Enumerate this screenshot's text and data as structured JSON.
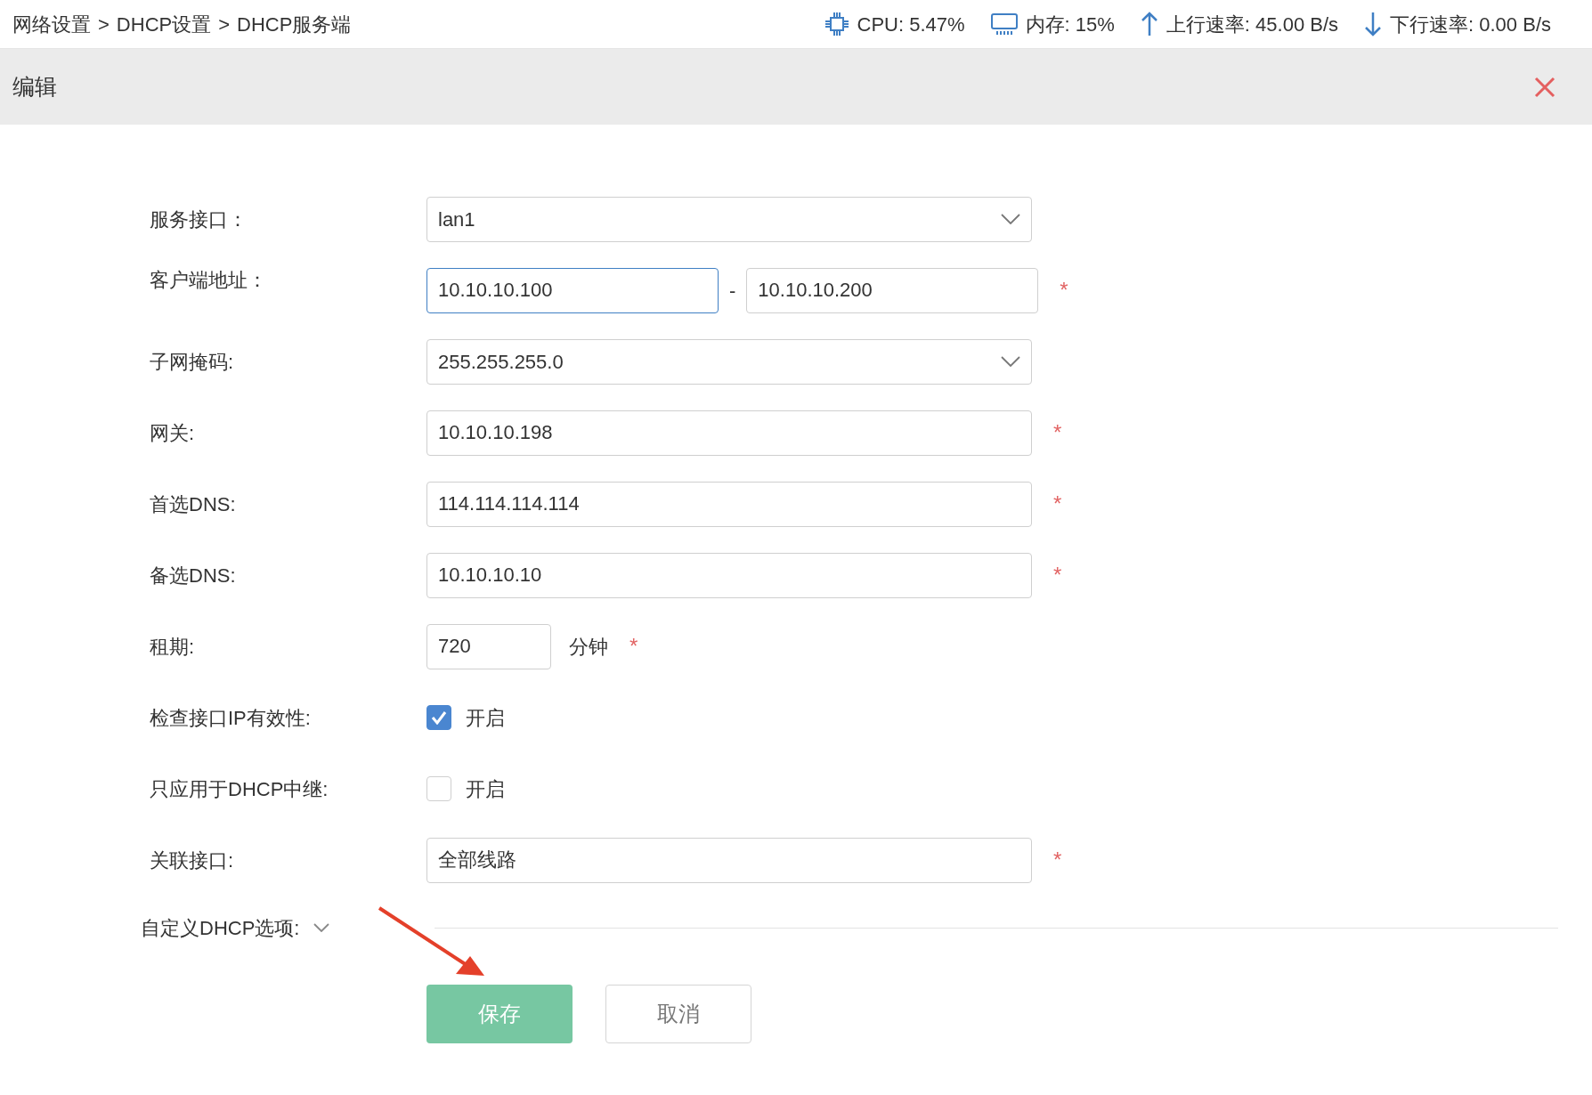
{
  "breadcrumb": [
    "网络设置",
    "DHCP设置",
    "DHCP服务端"
  ],
  "breadcrumb_separator": ">",
  "status": [
    {
      "kind": "cpu",
      "text": "CPU: 5.47%"
    },
    {
      "kind": "memory",
      "text": "内存: 15%"
    },
    {
      "kind": "upload",
      "text": "上行速率: 45.00 B/s"
    },
    {
      "kind": "download",
      "text": "下行速率: 0.00 B/s"
    }
  ],
  "dialog": {
    "title": "编辑"
  },
  "required_mark": "*",
  "fields": [
    {
      "kind": "select",
      "label": "服务接口：",
      "value": "lan1",
      "required": false
    },
    {
      "kind": "range",
      "label": "客户端地址：",
      "from": {
        "value": "10.10.10.100",
        "focused": true
      },
      "separator": "-",
      "to": {
        "value": "10.10.10.200",
        "focused": false
      },
      "required": true
    },
    {
      "kind": "select",
      "label": "子网掩码:",
      "value": "255.255.255.0",
      "required": false
    },
    {
      "kind": "text",
      "label": "网关:",
      "value": "10.10.10.198",
      "required": true
    },
    {
      "kind": "text",
      "label": "首选DNS:",
      "value": "114.114.114.114",
      "required": true
    },
    {
      "kind": "text",
      "label": "备选DNS:",
      "value": "10.10.10.10",
      "required": true
    },
    {
      "kind": "short",
      "label": "租期:",
      "value": "720",
      "unit": "分钟",
      "required": true
    },
    {
      "kind": "checkbox",
      "label": "检查接口IP有效性:",
      "option": "开启",
      "checked": true
    },
    {
      "kind": "checkbox",
      "label": "只应用于DHCP中继:",
      "option": "开启",
      "checked": false
    },
    {
      "kind": "text",
      "label": "关联接口:",
      "value": "全部线路",
      "required": true
    }
  ],
  "custom_options": {
    "label": "自定义DHCP选项:",
    "expanded": false
  },
  "buttons": [
    {
      "kind": "primary",
      "label": "保存"
    },
    {
      "kind": "secondary",
      "label": "取消"
    }
  ]
}
